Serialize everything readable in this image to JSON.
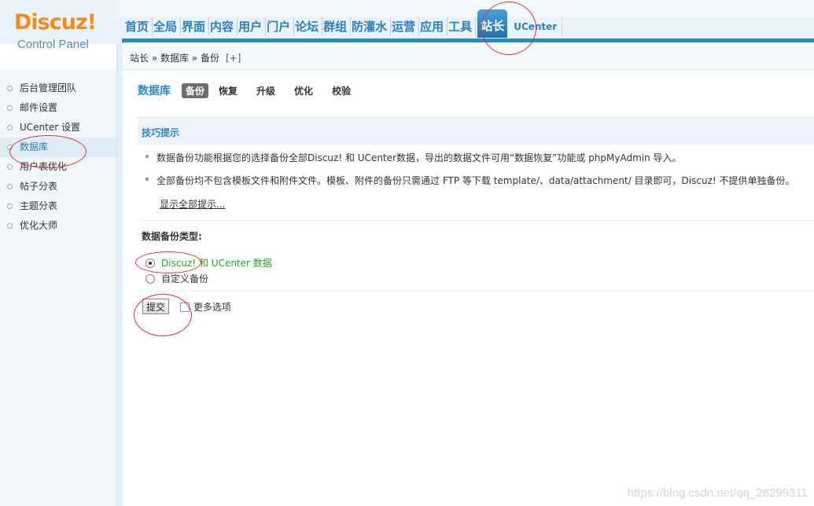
{
  "logo": {
    "main": "Discuz!",
    "sub": "Control Panel"
  },
  "nav": {
    "items": [
      {
        "label": "首页"
      },
      {
        "label": "全局"
      },
      {
        "label": "界面"
      },
      {
        "label": "内容"
      },
      {
        "label": "用户"
      },
      {
        "label": "门户"
      },
      {
        "label": "论坛"
      },
      {
        "label": "群组"
      },
      {
        "label": "防灌水"
      },
      {
        "label": "运营"
      },
      {
        "label": "应用"
      },
      {
        "label": "工具"
      }
    ],
    "active_label": "站长",
    "ucenter_label": "UCenter"
  },
  "breadcrumb": {
    "text": "站长 » 数据库 » 备份",
    "add": "[+]"
  },
  "sidebar": {
    "items": [
      {
        "label": "后台管理团队"
      },
      {
        "label": "邮件设置"
      },
      {
        "label": "UCenter 设置"
      },
      {
        "label": "数据库",
        "current": true
      },
      {
        "label": "用户表优化"
      },
      {
        "label": "帖子分表"
      },
      {
        "label": "主题分表"
      },
      {
        "label": "优化大师"
      }
    ]
  },
  "main": {
    "title": "数据库",
    "tabs": [
      {
        "label": "备份",
        "active": true
      },
      {
        "label": "恢复"
      },
      {
        "label": "升级"
      },
      {
        "label": "优化"
      },
      {
        "label": "校验"
      }
    ],
    "tips_title": "技巧提示",
    "tips": [
      "数据备份功能根据您的选择备份全部Discuz! 和 UCenter数据，导出的数据文件可用“数据恢复”功能或 phpMyAdmin 导入。",
      "全部备份均不包含模板文件和附件文件。模板、附件的备份只需通过 FTP 等下载 template/、data/attachment/ 目录即可，Discuz! 不提供单独备份。"
    ],
    "tips_more": "显示全部提示...",
    "type_label": "数据备份类型:",
    "options": [
      {
        "label_a": "Discuz!",
        "label_b": " 和 ",
        "label_c": "UCenter 数据",
        "checked": true
      },
      {
        "label": "自定义备份",
        "checked": false
      }
    ],
    "submit_label": "提交",
    "more_options_label": "更多选项"
  },
  "watermark": "https://blog.csdn.net/qq_28299311",
  "colors": {
    "accent": "#2d88c8",
    "logo": "#f58a1f",
    "annotation": "#e0303a",
    "option_green": "#2aa32a"
  }
}
